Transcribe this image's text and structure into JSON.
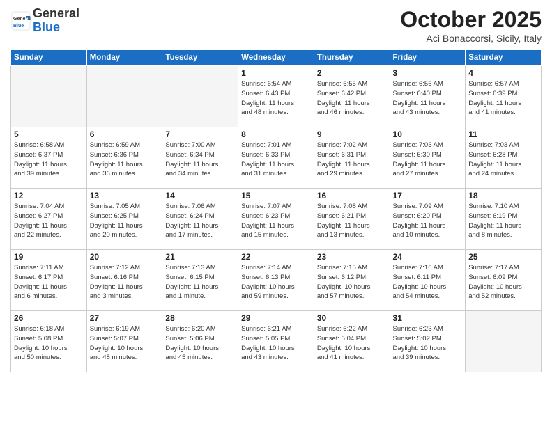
{
  "logo": {
    "general": "General",
    "blue": "Blue"
  },
  "title": "October 2025",
  "subtitle": "Aci Bonaccorsi, Sicily, Italy",
  "days_of_week": [
    "Sunday",
    "Monday",
    "Tuesday",
    "Wednesday",
    "Thursday",
    "Friday",
    "Saturday"
  ],
  "weeks": [
    [
      {
        "day": "",
        "info": ""
      },
      {
        "day": "",
        "info": ""
      },
      {
        "day": "",
        "info": ""
      },
      {
        "day": "1",
        "info": "Sunrise: 6:54 AM\nSunset: 6:43 PM\nDaylight: 11 hours\nand 48 minutes."
      },
      {
        "day": "2",
        "info": "Sunrise: 6:55 AM\nSunset: 6:42 PM\nDaylight: 11 hours\nand 46 minutes."
      },
      {
        "day": "3",
        "info": "Sunrise: 6:56 AM\nSunset: 6:40 PM\nDaylight: 11 hours\nand 43 minutes."
      },
      {
        "day": "4",
        "info": "Sunrise: 6:57 AM\nSunset: 6:39 PM\nDaylight: 11 hours\nand 41 minutes."
      }
    ],
    [
      {
        "day": "5",
        "info": "Sunrise: 6:58 AM\nSunset: 6:37 PM\nDaylight: 11 hours\nand 39 minutes."
      },
      {
        "day": "6",
        "info": "Sunrise: 6:59 AM\nSunset: 6:36 PM\nDaylight: 11 hours\nand 36 minutes."
      },
      {
        "day": "7",
        "info": "Sunrise: 7:00 AM\nSunset: 6:34 PM\nDaylight: 11 hours\nand 34 minutes."
      },
      {
        "day": "8",
        "info": "Sunrise: 7:01 AM\nSunset: 6:33 PM\nDaylight: 11 hours\nand 31 minutes."
      },
      {
        "day": "9",
        "info": "Sunrise: 7:02 AM\nSunset: 6:31 PM\nDaylight: 11 hours\nand 29 minutes."
      },
      {
        "day": "10",
        "info": "Sunrise: 7:03 AM\nSunset: 6:30 PM\nDaylight: 11 hours\nand 27 minutes."
      },
      {
        "day": "11",
        "info": "Sunrise: 7:03 AM\nSunset: 6:28 PM\nDaylight: 11 hours\nand 24 minutes."
      }
    ],
    [
      {
        "day": "12",
        "info": "Sunrise: 7:04 AM\nSunset: 6:27 PM\nDaylight: 11 hours\nand 22 minutes."
      },
      {
        "day": "13",
        "info": "Sunrise: 7:05 AM\nSunset: 6:25 PM\nDaylight: 11 hours\nand 20 minutes."
      },
      {
        "day": "14",
        "info": "Sunrise: 7:06 AM\nSunset: 6:24 PM\nDaylight: 11 hours\nand 17 minutes."
      },
      {
        "day": "15",
        "info": "Sunrise: 7:07 AM\nSunset: 6:23 PM\nDaylight: 11 hours\nand 15 minutes."
      },
      {
        "day": "16",
        "info": "Sunrise: 7:08 AM\nSunset: 6:21 PM\nDaylight: 11 hours\nand 13 minutes."
      },
      {
        "day": "17",
        "info": "Sunrise: 7:09 AM\nSunset: 6:20 PM\nDaylight: 11 hours\nand 10 minutes."
      },
      {
        "day": "18",
        "info": "Sunrise: 7:10 AM\nSunset: 6:19 PM\nDaylight: 11 hours\nand 8 minutes."
      }
    ],
    [
      {
        "day": "19",
        "info": "Sunrise: 7:11 AM\nSunset: 6:17 PM\nDaylight: 11 hours\nand 6 minutes."
      },
      {
        "day": "20",
        "info": "Sunrise: 7:12 AM\nSunset: 6:16 PM\nDaylight: 11 hours\nand 3 minutes."
      },
      {
        "day": "21",
        "info": "Sunrise: 7:13 AM\nSunset: 6:15 PM\nDaylight: 11 hours\nand 1 minute."
      },
      {
        "day": "22",
        "info": "Sunrise: 7:14 AM\nSunset: 6:13 PM\nDaylight: 10 hours\nand 59 minutes."
      },
      {
        "day": "23",
        "info": "Sunrise: 7:15 AM\nSunset: 6:12 PM\nDaylight: 10 hours\nand 57 minutes."
      },
      {
        "day": "24",
        "info": "Sunrise: 7:16 AM\nSunset: 6:11 PM\nDaylight: 10 hours\nand 54 minutes."
      },
      {
        "day": "25",
        "info": "Sunrise: 7:17 AM\nSunset: 6:09 PM\nDaylight: 10 hours\nand 52 minutes."
      }
    ],
    [
      {
        "day": "26",
        "info": "Sunrise: 6:18 AM\nSunset: 5:08 PM\nDaylight: 10 hours\nand 50 minutes."
      },
      {
        "day": "27",
        "info": "Sunrise: 6:19 AM\nSunset: 5:07 PM\nDaylight: 10 hours\nand 48 minutes."
      },
      {
        "day": "28",
        "info": "Sunrise: 6:20 AM\nSunset: 5:06 PM\nDaylight: 10 hours\nand 45 minutes."
      },
      {
        "day": "29",
        "info": "Sunrise: 6:21 AM\nSunset: 5:05 PM\nDaylight: 10 hours\nand 43 minutes."
      },
      {
        "day": "30",
        "info": "Sunrise: 6:22 AM\nSunset: 5:04 PM\nDaylight: 10 hours\nand 41 minutes."
      },
      {
        "day": "31",
        "info": "Sunrise: 6:23 AM\nSunset: 5:02 PM\nDaylight: 10 hours\nand 39 minutes."
      },
      {
        "day": "",
        "info": ""
      }
    ]
  ]
}
